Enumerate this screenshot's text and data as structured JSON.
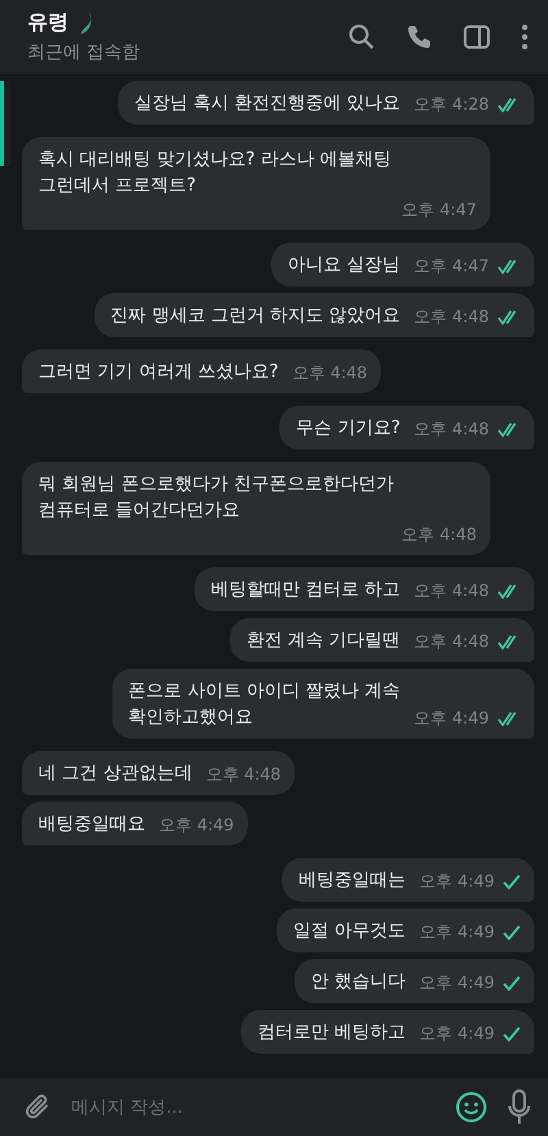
{
  "header": {
    "name": "유령",
    "status": "최근에 접속함"
  },
  "messages": [
    {
      "kind": "outgoing",
      "text": "실장님 혹시 환전진행중에 있나요",
      "time": "오후 4:28",
      "read": true
    },
    {
      "kind": "incoming",
      "text": "혹시 대리배팅 맞기셨나요? 라스나 에볼채팅\n그런데서 프로젝트?",
      "time": "오후 4:47"
    },
    {
      "kind": "outgoing",
      "text": "아니요 실장님",
      "time": "오후 4:47",
      "read": true
    },
    {
      "kind": "outgoing",
      "text": "진짜 맹세코 그런거 하지도 않았어요",
      "time": "오후 4:48",
      "read": true
    },
    {
      "kind": "incoming",
      "text": "그러면 기기 여러게 쓰셨나요?",
      "time": "오후 4:48"
    },
    {
      "kind": "outgoing",
      "text": "무슨 기기요?",
      "time": "오후 4:48",
      "read": true
    },
    {
      "kind": "incoming",
      "text": "뭐 회원님 폰으로했다가 친구폰으로한다던가\n컴퓨터로 들어간다던가요",
      "time": "오후 4:48"
    },
    {
      "kind": "outgoing",
      "text": "베팅할때만 컴터로 하고",
      "time": "오후 4:48",
      "read": true
    },
    {
      "kind": "outgoing",
      "text": "환전 계속 기다릴땐",
      "time": "오후 4:48",
      "read": true
    },
    {
      "kind": "outgoing",
      "text": "폰으로 사이트 아이디 짤렸나 계속\n확인하고했어요",
      "time": "오후 4:49",
      "read": true
    },
    {
      "kind": "incoming",
      "text": "네 그건 상관없는데",
      "time": "오후 4:48"
    },
    {
      "kind": "incoming",
      "text": "배팅중일때요",
      "time": "오후 4:49"
    },
    {
      "kind": "outgoing",
      "text": "베팅중일때는",
      "time": "오후 4:49",
      "read": false
    },
    {
      "kind": "outgoing",
      "text": "일절 아무것도",
      "time": "오후 4:49",
      "read": false
    },
    {
      "kind": "outgoing",
      "text": "안 했습니다",
      "time": "오후 4:49",
      "read": false
    },
    {
      "kind": "outgoing",
      "text": "컴터로만 베팅하고",
      "time": "오후 4:49",
      "read": false
    }
  ],
  "composer": {
    "placeholder": "메시지 작성..."
  }
}
